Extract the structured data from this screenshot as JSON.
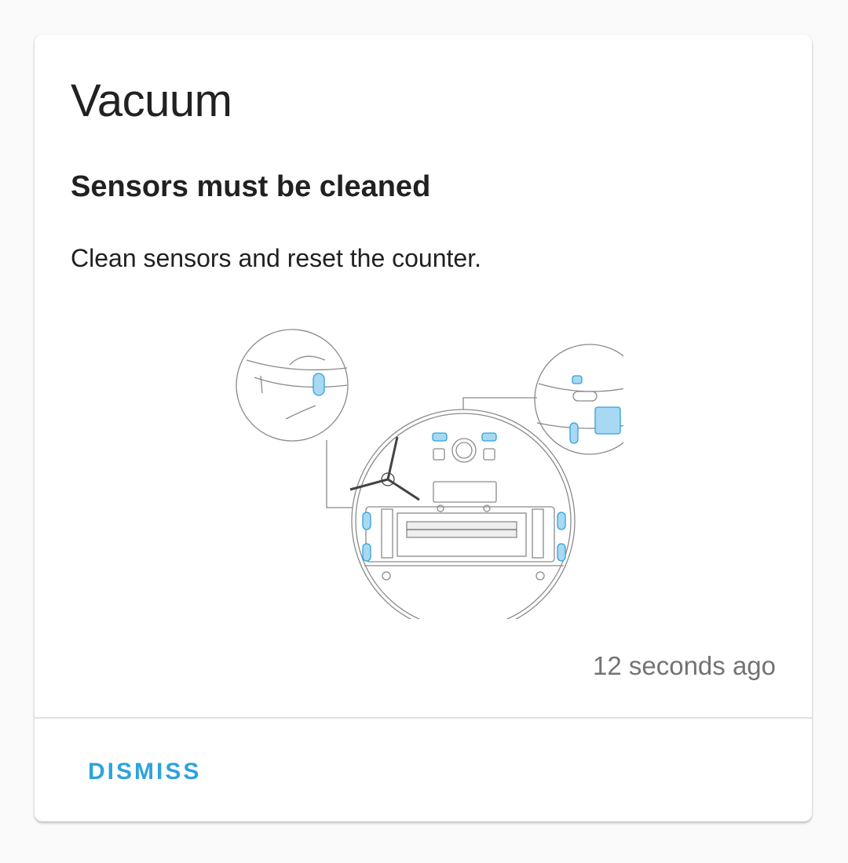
{
  "card": {
    "title": "Vacuum",
    "subtitle": "Sensors must be cleaned",
    "message": "Clean sensors and reset the counter.",
    "timestamp": "12 seconds ago",
    "illustration_icon": "robot-vacuum-sensors-illustration"
  },
  "actions": {
    "dismiss_label": "DISMISS"
  },
  "colors": {
    "accent": "#2ea3dc",
    "sensor_highlight": "#a9d8f2",
    "background": "#fafafa",
    "card": "#ffffff"
  }
}
